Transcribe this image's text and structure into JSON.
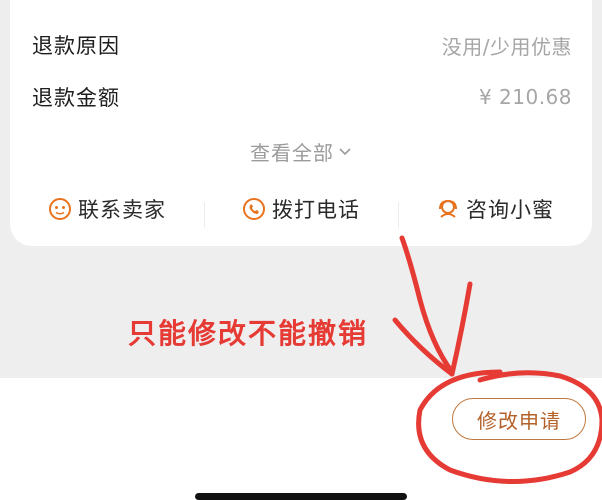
{
  "refund": {
    "reason_label": "退款原因",
    "reason_value": "没用/少用优惠",
    "amount_label": "退款金额",
    "amount_value": "¥ 210.68",
    "see_all": "查看全部"
  },
  "actions": [
    {
      "label": "联系卖家",
      "icon": "smiley-chat-icon"
    },
    {
      "label": "拨打电话",
      "icon": "phone-icon"
    },
    {
      "label": "咨询小蜜",
      "icon": "headset-icon"
    }
  ],
  "annotation": {
    "text": "只能修改不能撤销"
  },
  "bottom": {
    "modify_button": "修改申请"
  },
  "colors": {
    "accent": "#e8731e",
    "annotation_red": "#e63b35",
    "button_text": "#b4622a",
    "background": "#efeeef"
  }
}
